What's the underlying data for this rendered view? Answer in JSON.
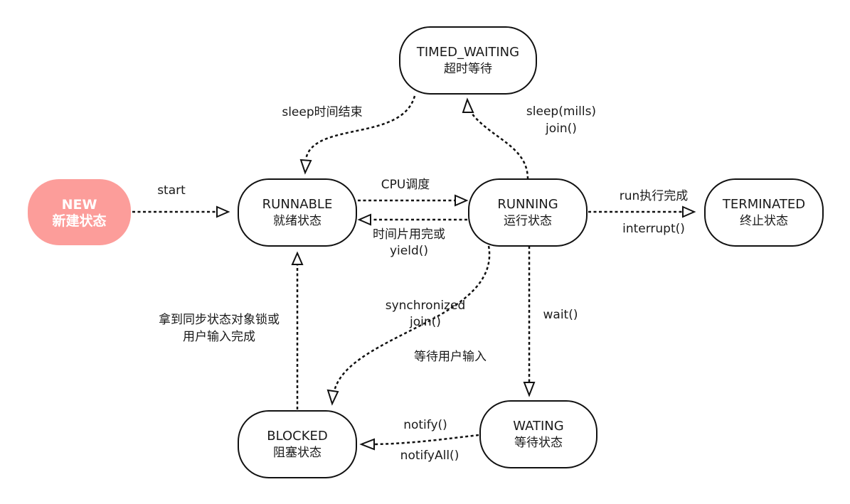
{
  "states": {
    "new": {
      "en": "NEW",
      "zh": "新建状态"
    },
    "runnable": {
      "en": "RUNNABLE",
      "zh": "就绪状态"
    },
    "running": {
      "en": "RUNNING",
      "zh": "运行状态"
    },
    "timed_waiting": {
      "en": "TIMED_WAITING",
      "zh": "超时等待"
    },
    "terminated": {
      "en": "TERMINATED",
      "zh": "终止状态"
    },
    "blocked": {
      "en": "BLOCKED",
      "zh": "阻塞状态"
    },
    "waiting": {
      "en": "WATING",
      "zh": "等待状态"
    }
  },
  "transitions": {
    "start": "start",
    "cpu_schedule": "CPU调度",
    "timeslice": [
      "时间片用完或",
      "yield()"
    ],
    "sleep_end": "sleep时间结束",
    "sleep_join": [
      "sleep(mills)",
      "join()"
    ],
    "run_done": "run执行完成",
    "interrupt": "interrupt()",
    "sync_join": [
      "synchronized",
      "join()"
    ],
    "wait_input": "等待用户输入",
    "wait": "wait()",
    "lock_acquired": [
      "拿到同步状态对象锁或",
      "用户输入完成"
    ],
    "notify": "notify()",
    "notify_all": "notifyAll()"
  },
  "colors": {
    "new_fill": "#fc9d9a",
    "stroke": "#111111"
  }
}
